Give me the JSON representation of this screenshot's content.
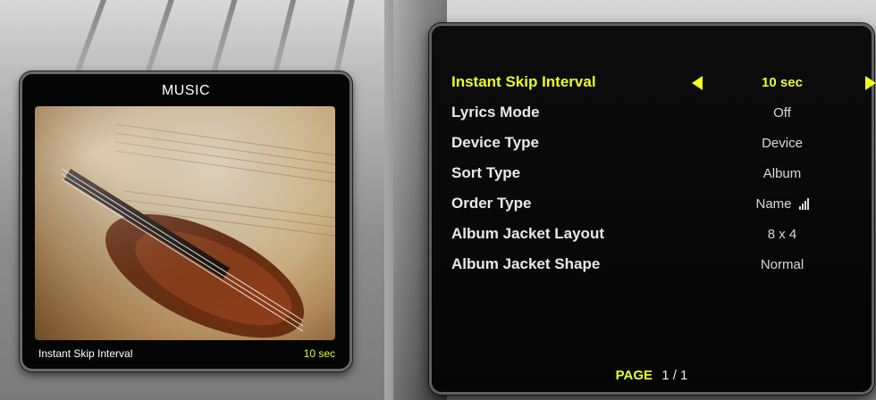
{
  "preview": {
    "title": "MUSIC",
    "footer_label": "Instant Skip Interval",
    "footer_value": "10 sec"
  },
  "menu": {
    "items": [
      {
        "label": "Instant Skip Interval",
        "value": "10 sec"
      },
      {
        "label": "Lyrics Mode",
        "value": "Off"
      },
      {
        "label": "Device Type",
        "value": "Device"
      },
      {
        "label": "Sort Type",
        "value": "Album"
      },
      {
        "label": "Order Type",
        "value": "Name"
      },
      {
        "label": "Album Jacket Layout",
        "value": "8 x 4"
      },
      {
        "label": "Album Jacket Shape",
        "value": "Normal"
      }
    ],
    "page_label": "PAGE",
    "page_value": "1 / 1",
    "selected_index": 0
  },
  "colors": {
    "highlight": "#e8ff2a",
    "text": "#e9e9e9",
    "panel": "#050505"
  },
  "icons": {
    "left_arrow": "left-arrow-icon",
    "right_arrow": "right-arrow-icon",
    "order": "sort-order-icon"
  }
}
